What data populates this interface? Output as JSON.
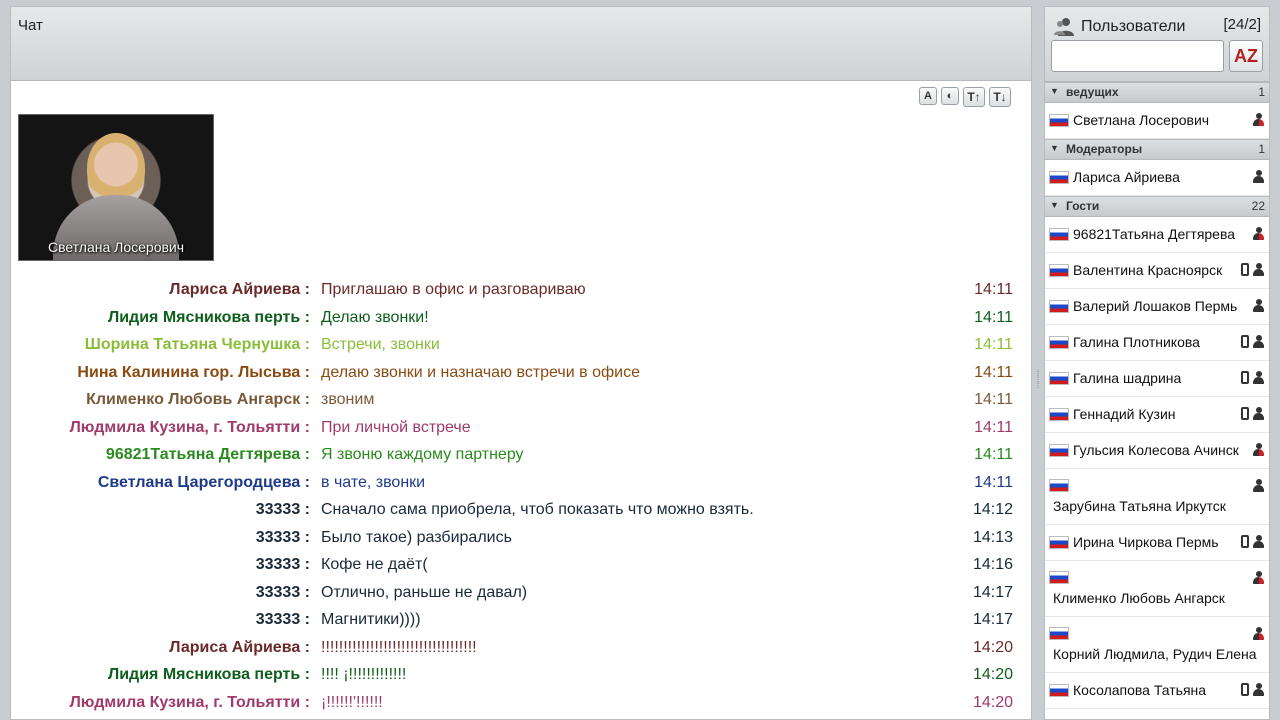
{
  "chat": {
    "title": "Чат",
    "video_name": "Светлана Лосерович",
    "toolbar": [
      "A",
      "◐",
      "T↑",
      "T↓"
    ],
    "messages": [
      {
        "author": "Лариса Айриева :",
        "text": "Приглашаю в офис и разговариваю",
        "time": "14:11",
        "color": "#6b2a2a"
      },
      {
        "author": "Лидия Мясникова перть :",
        "text": "Делаю звонки!",
        "time": "14:11",
        "color": "#0f5e1d"
      },
      {
        "author": "Шорина Татьяна Чернушка :",
        "text": "Встречи, звонки",
        "time": "14:11",
        "color": "#8bbd3a"
      },
      {
        "author": "Нина Калинина гор. Лысьва :",
        "text": "делаю звонки и назначаю встречи в офисе",
        "time": "14:11",
        "color": "#8a4b12"
      },
      {
        "author": "Клименко Любовь Ангарск :",
        "text": "звоним",
        "time": "14:11",
        "color": "#7a5a3a"
      },
      {
        "author": "Людмила Кузина, г. Тольятти :",
        "text": "При личной встрече",
        "time": "14:11",
        "color": "#a03a6a"
      },
      {
        "author": "96821Татьяна Дегтярева :",
        "text": "Я звоню каждому партнеру",
        "time": "14:11",
        "color": "#2b8a1f"
      },
      {
        "author": "Светлана Царегородцева :",
        "text": "в чате, звонки",
        "time": "14:11",
        "color": "#1e3a8a"
      },
      {
        "author": "33333 :",
        "text": "Сначало сама приобрела, чтоб показать что можно взять.",
        "time": "14:12",
        "color": "#1a2a3a"
      },
      {
        "author": "33333 :",
        "text": "Было такое) разбирались",
        "time": "14:13",
        "color": "#1a2a3a"
      },
      {
        "author": "33333 :",
        "text": "Кофе не даёт(",
        "time": "14:16",
        "color": "#1a2a3a"
      },
      {
        "author": "33333 :",
        "text": "Отлично, раньше не давал)",
        "time": "14:17",
        "color": "#1a2a3a"
      },
      {
        "author": "33333 :",
        "text": "Магнитики))))",
        "time": "14:17",
        "color": "#1a2a3a"
      },
      {
        "author": "Лариса Айриева :",
        "text": "!!!!!!!!!!!!!!!!!!!!!!!!!!!!!!!!!!!",
        "time": "14:20",
        "color": "#6b2a2a"
      },
      {
        "author": "Лидия Мясникова перть :",
        "text": "!!!! ¡!!!!!!!!!!!!!",
        "time": "14:20",
        "color": "#0f5e1d"
      },
      {
        "author": "Людмила Кузина, г. Тольятти :",
        "text": "¡!!!!!!'!!!!!!",
        "time": "14:20",
        "color": "#a03a6a"
      }
    ]
  },
  "users": {
    "title": "Пользователи",
    "count": "[24/2]",
    "search_placeholder": "",
    "sort_label": "AZ",
    "groups": [
      {
        "name": "ведущих",
        "count": "1",
        "users": [
          {
            "name": "Светлана Лосерович",
            "icons": [
              "speaker"
            ],
            "layout": "single"
          }
        ]
      },
      {
        "name": "Модераторы",
        "count": "1",
        "users": [
          {
            "name": "Лариса Айриева",
            "icons": [
              "user"
            ],
            "layout": "single"
          }
        ]
      },
      {
        "name": "Гости",
        "count": "22",
        "users": [
          {
            "name": "96821Татьяна Дегтярева",
            "icons": [
              "speaker"
            ],
            "layout": "single"
          },
          {
            "name": "Валентина Красноярск",
            "icons": [
              "phone",
              "user"
            ],
            "layout": "single"
          },
          {
            "name": "Валерий Лошаков Пермь",
            "icons": [
              "user"
            ],
            "layout": "single"
          },
          {
            "name": "Галина Плотникова",
            "icons": [
              "phone",
              "user"
            ],
            "layout": "single"
          },
          {
            "name": "Галина шадрина",
            "icons": [
              "phone",
              "user"
            ],
            "layout": "single"
          },
          {
            "name": "Геннадий Кузин",
            "icons": [
              "phone",
              "user"
            ],
            "layout": "single"
          },
          {
            "name": "Гульсия Колесова Ачинск",
            "icons": [
              "speaker"
            ],
            "layout": "single"
          },
          {
            "name": "Зарубина Татьяна Иркутск",
            "icons": [
              "user"
            ],
            "layout": "double"
          },
          {
            "name": "Ирина Чиркова Пермь",
            "icons": [
              "phone",
              "user"
            ],
            "layout": "single"
          },
          {
            "name": "Клименко Любовь Ангарск",
            "icons": [
              "speaker"
            ],
            "layout": "double"
          },
          {
            "name": "Корний Людмила, Рудич Елена",
            "icons": [
              "speaker"
            ],
            "layout": "double"
          },
          {
            "name": "Косолапова Татьяна",
            "icons": [
              "phone",
              "user"
            ],
            "layout": "single"
          }
        ]
      }
    ]
  }
}
